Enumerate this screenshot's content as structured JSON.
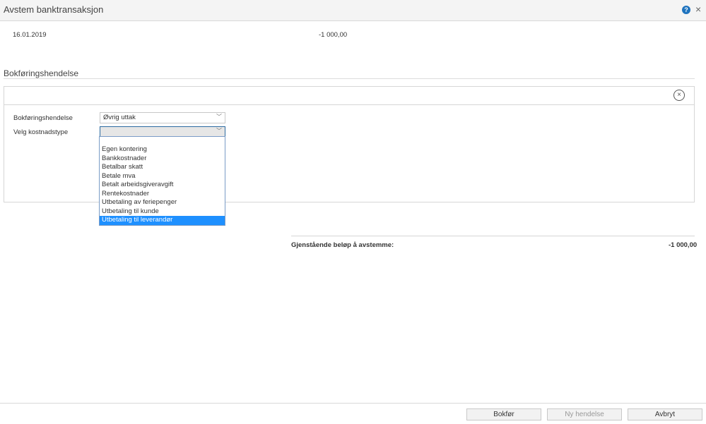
{
  "window": {
    "title": "Avstem banktransaksjon"
  },
  "transaction": {
    "date": "16.01.2019",
    "amount": "-1 000,00"
  },
  "section": {
    "title": "Bokføringshendelse"
  },
  "form": {
    "event_label": "Bokføringshendelse",
    "event_value": "Øvrig uttak",
    "cost_type_label": "Velg kostnadstype",
    "cost_type_value": ""
  },
  "dropdown": {
    "options": [
      "Egen kontering",
      "Bankkostnader",
      "Betalbar skatt",
      "Betale mva",
      "Betalt arbeidsgiveravgift",
      "Rentekostnader",
      "Utbetaling av feriepenger",
      "Utbetaling til kunde",
      "Utbetaling til leverandør"
    ],
    "selected_index": 8
  },
  "summary": {
    "label": "Gjenstående beløp å avstemme:",
    "value": "-1 000,00"
  },
  "footer": {
    "post_label": "Bokfør",
    "new_event_label": "Ny hendelse",
    "cancel_label": "Avbryt"
  },
  "colors": {
    "accent": "#1e90ff",
    "help": "#1e73be"
  },
  "icons": {
    "help": "help-icon",
    "close": "close-icon",
    "panel_close": "circle-close-icon",
    "chevron": "chevron-down-icon"
  }
}
